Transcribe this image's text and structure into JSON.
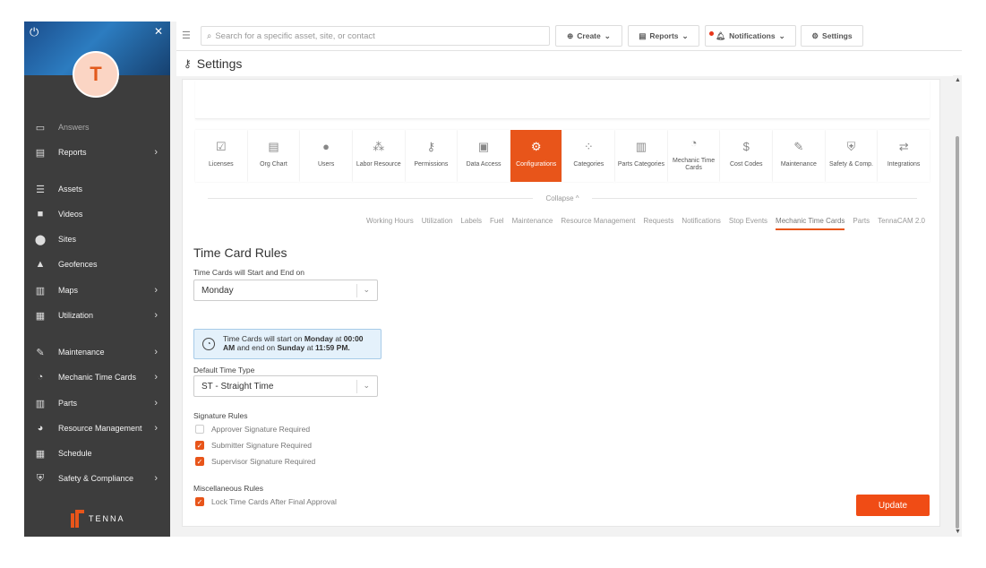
{
  "sidebar": {
    "avatar_initial": "T",
    "items": [
      {
        "label": "Answers",
        "icon": "chat-icon",
        "chevron": false
      },
      {
        "label": "Reports",
        "icon": "document-icon",
        "chevron": true
      },
      {
        "label": "Assets",
        "icon": "list-icon",
        "chevron": false
      },
      {
        "label": "Videos",
        "icon": "video-icon",
        "chevron": false
      },
      {
        "label": "Sites",
        "icon": "pin-icon",
        "chevron": false
      },
      {
        "label": "Geofences",
        "icon": "shapes-icon",
        "chevron": false
      },
      {
        "label": "Maps",
        "icon": "map-icon",
        "chevron": true
      },
      {
        "label": "Utilization",
        "icon": "bar-chart-icon",
        "chevron": true
      },
      {
        "label": "Maintenance",
        "icon": "wrench-icon",
        "chevron": true
      },
      {
        "label": "Mechanic Time Cards",
        "icon": "clock-icon",
        "chevron": true
      },
      {
        "label": "Parts",
        "icon": "book-icon",
        "chevron": true
      },
      {
        "label": "Resource Management",
        "icon": "pie-icon",
        "chevron": true
      },
      {
        "label": "Schedule",
        "icon": "calendar-icon",
        "chevron": false
      },
      {
        "label": "Safety & Compliance",
        "icon": "shield-icon",
        "chevron": true
      }
    ],
    "logo_text": "TENNA"
  },
  "topbar": {
    "search_placeholder": "Search for a specific asset, site, or contact",
    "create_label": "Create",
    "reports_label": "Reports",
    "notifications_label": "Notifications",
    "settings_label": "Settings"
  },
  "page": {
    "title": "Settings"
  },
  "config_tabs": [
    {
      "label": "Licenses",
      "icon": "clipboard-icon",
      "active": false
    },
    {
      "label": "Org Chart",
      "icon": "org-chart-icon",
      "active": false
    },
    {
      "label": "Users",
      "icon": "user-icon",
      "active": false
    },
    {
      "label": "Labor Resource",
      "icon": "group-icon",
      "active": false
    },
    {
      "label": "Permissions",
      "icon": "key-icon",
      "active": false
    },
    {
      "label": "Data Access",
      "icon": "lock-icon",
      "active": false
    },
    {
      "label": "Configurations",
      "icon": "configurations-icon",
      "active": true
    },
    {
      "label": "Categories",
      "icon": "categories-icon",
      "active": false
    },
    {
      "label": "Parts Categories",
      "icon": "book-icon",
      "active": false
    },
    {
      "label": "Mechanic Time Cards",
      "icon": "clock-icon",
      "active": false
    },
    {
      "label": "Cost Codes",
      "icon": "dollar-icon",
      "active": false
    },
    {
      "label": "Maintenance",
      "icon": "wrench-icon",
      "active": false
    },
    {
      "label": "Safety & Comp.",
      "icon": "shield-icon",
      "active": false
    },
    {
      "label": "Integrations",
      "icon": "arrows-icon",
      "active": false
    }
  ],
  "collapse_label": "Collapse ^",
  "subtabs": [
    {
      "label": "Working Hours",
      "active": false
    },
    {
      "label": "Utilization",
      "active": false
    },
    {
      "label": "Labels",
      "active": false
    },
    {
      "label": "Fuel",
      "active": false
    },
    {
      "label": "Maintenance",
      "active": false
    },
    {
      "label": "Resource Management",
      "active": false
    },
    {
      "label": "Requests",
      "active": false
    },
    {
      "label": "Notifications",
      "active": false
    },
    {
      "label": "Stop Events",
      "active": false
    },
    {
      "label": "Mechanic Time Cards",
      "active": true
    },
    {
      "label": "Parts",
      "active": false
    },
    {
      "label": "TennaCAM 2.0",
      "active": false
    }
  ],
  "form": {
    "title": "Time Card Rules",
    "start_label": "Time Cards will Start and End on",
    "start_value": "Monday",
    "info_prefix": "Time Cards will start on ",
    "info_day_start": "Monday",
    "info_mid1": " at ",
    "info_time_start": "00:00 AM",
    "info_mid2": " and end on ",
    "info_day_end": "Sunday",
    "info_mid3": " at ",
    "info_time_end": "11:59 PM.",
    "default_type_label": "Default Time Type",
    "default_type_value": "ST - Straight Time",
    "signature_label": "Signature Rules",
    "approver_label": "Approver Signature Required",
    "approver_checked": false,
    "submitter_label": "Submitter Signature Required",
    "submitter_checked": true,
    "supervisor_label": "Supervisor Signature Required",
    "supervisor_checked": true,
    "misc_label": "Miscellaneous Rules",
    "lock_label": "Lock Time Cards After Final Approval",
    "lock_checked": true,
    "update_label": "Update"
  },
  "colors": {
    "accent": "#e8551a",
    "sidebar": "#3d3d3d",
    "info_bg": "#e4f1fb"
  }
}
